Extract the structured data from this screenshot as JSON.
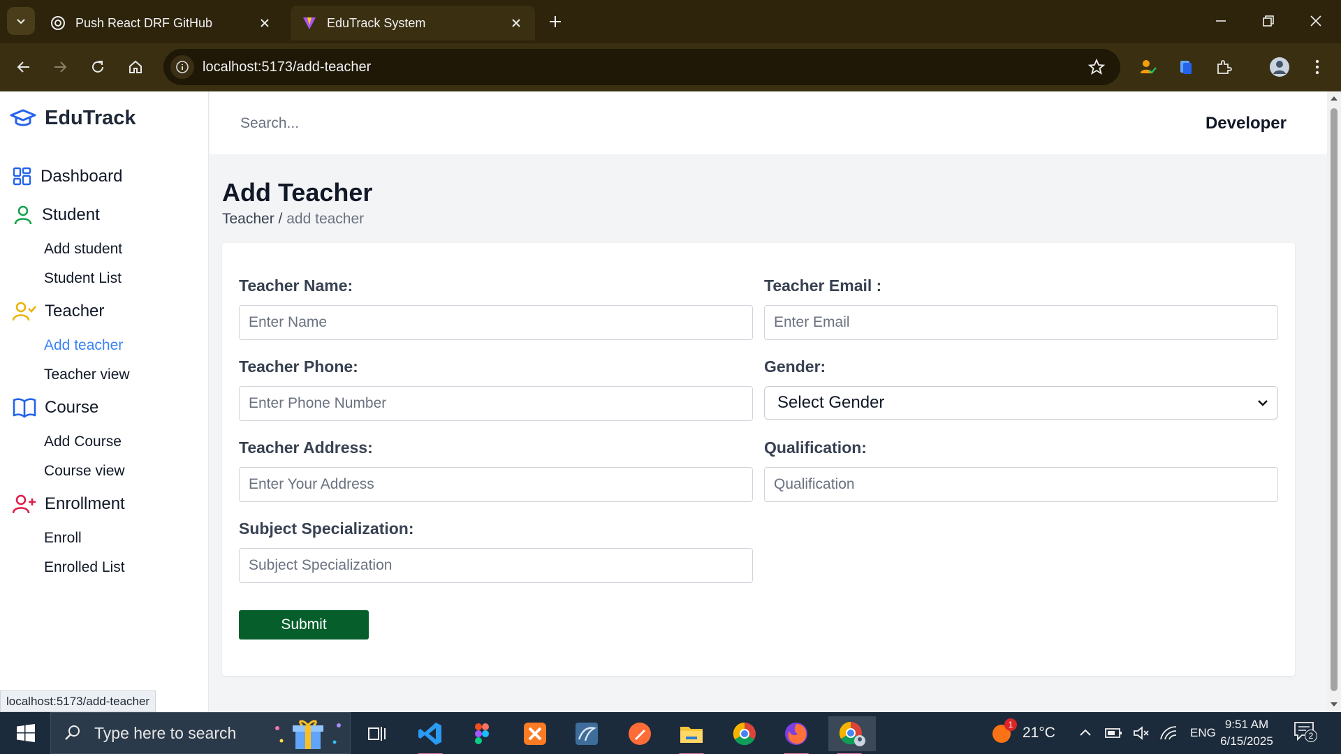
{
  "browser": {
    "tabs": [
      {
        "title": "Push React DRF GitHub",
        "active": false
      },
      {
        "title": "EduTrack System",
        "active": true
      }
    ],
    "url": "localhost:5173/add-teacher",
    "status_url": "localhost:5173/add-teacher"
  },
  "app": {
    "brand": "EduTrack",
    "search_placeholder": "Search...",
    "user": "Developer",
    "sidebar": {
      "groups": [
        {
          "label": "Dashboard",
          "items": []
        },
        {
          "label": "Student",
          "items": [
            "Add student",
            "Student List"
          ]
        },
        {
          "label": "Teacher",
          "items": [
            "Add teacher",
            "Teacher view"
          ]
        },
        {
          "label": "Course",
          "items": [
            "Add Course",
            "Course view"
          ]
        },
        {
          "label": "Enrollment",
          "items": [
            "Enroll",
            "Enrolled List"
          ]
        }
      ],
      "active_item": "Add teacher"
    },
    "page": {
      "title": "Add Teacher",
      "breadcrumb": {
        "parent": "Teacher",
        "separator": " / ",
        "current": "add teacher"
      }
    },
    "form": {
      "name": {
        "label": "Teacher Name:",
        "placeholder": "Enter Name"
      },
      "email": {
        "label": "Teacher Email :",
        "placeholder": "Enter Email"
      },
      "phone": {
        "label": "Teacher Phone:",
        "placeholder": "Enter Phone Number"
      },
      "gender": {
        "label": "Gender:",
        "selected": "Select Gender"
      },
      "address": {
        "label": "Teacher Address:",
        "placeholder": "Enter Your Address"
      },
      "qualification": {
        "label": "Qualification:",
        "placeholder": "Qualification"
      },
      "subject": {
        "label": "Subject Specialization:",
        "placeholder": "Subject Specialization"
      },
      "submit": "Submit"
    }
  },
  "taskbar": {
    "search_placeholder": "Type here to search",
    "weather": "21°C",
    "weather_badge": "1",
    "language": "ENG",
    "time": "9:51 AM",
    "date": "6/15/2025",
    "notification_count": "2"
  },
  "colors": {
    "accent_blue": "#3b82f6",
    "submit_green": "#065f2b",
    "student_icon": "#16a34a",
    "teacher_icon": "#eab308",
    "course_icon": "#2563eb",
    "enrollment_icon": "#e11d48"
  }
}
